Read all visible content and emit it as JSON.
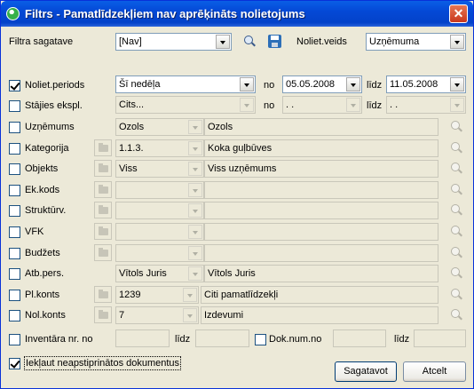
{
  "window": {
    "title": "Filtrs - Pamatlīdzekļiem nav aprēķināts nolietojums",
    "close": "✕"
  },
  "template": {
    "label": "Filtra sagatave",
    "value": "[Nav]"
  },
  "noliet_veids": {
    "label": "Noliet.veids",
    "value": "Uzņēmuma"
  },
  "period": {
    "label": "Noliet.periods",
    "checked": true,
    "value": "Šī nedēļa",
    "no_label": "no",
    "from": "05.05.2008",
    "lidz_label": "līdz",
    "to": "11.05.2008"
  },
  "stajies": {
    "label": "Stājies ekspl.",
    "checked": false,
    "value": "Cits...",
    "no_label": "no",
    "from": " .  .",
    "lidz_label": "līdz",
    "to": " .  ."
  },
  "rows": [
    {
      "key": "uznemums",
      "label": "Uzņēmums",
      "checked": false,
      "code": "Ozols",
      "name": "Ozols"
    },
    {
      "key": "kategorija",
      "label": "Kategorija",
      "checked": false,
      "code": "1.1.3.",
      "name": "Koka guļbūves"
    },
    {
      "key": "objekts",
      "label": "Objekts",
      "checked": false,
      "code": "Viss",
      "name": "Viss uzņēmums"
    },
    {
      "key": "ek-kods",
      "label": "Ek.kods",
      "checked": false,
      "code": "",
      "name": ""
    },
    {
      "key": "strukturv",
      "label": "Struktūrv.",
      "checked": false,
      "code": "",
      "name": ""
    },
    {
      "key": "vfk",
      "label": "VFK",
      "checked": false,
      "code": "",
      "name": ""
    },
    {
      "key": "budzets",
      "label": "Budžets",
      "checked": false,
      "code": "",
      "name": ""
    },
    {
      "key": "atb-pers",
      "label": "Atb.pers.",
      "checked": false,
      "code": "Vītols Juris",
      "name": "Vītols Juris"
    },
    {
      "key": "pl-konts",
      "label": "Pl.konts",
      "checked": false,
      "code": "1239",
      "name": "Citi pamatlīdzekļi"
    },
    {
      "key": "nol-konts",
      "label": "Nol.konts",
      "checked": false,
      "code": "7",
      "name": "Izdevumi"
    }
  ],
  "inventar": {
    "label": "Inventāra nr. no",
    "lidz_label": "līdz",
    "from": "",
    "to": ""
  },
  "dok_num": {
    "label": "Dok.num.no",
    "lidz_label": "līdz",
    "from": "",
    "to": ""
  },
  "include_unapproved": {
    "label": "Iekļaut neapstiprinātos dokumentus",
    "checked": true
  },
  "buttons": {
    "ok": "Sagatavot",
    "cancel": "Atcelt"
  }
}
